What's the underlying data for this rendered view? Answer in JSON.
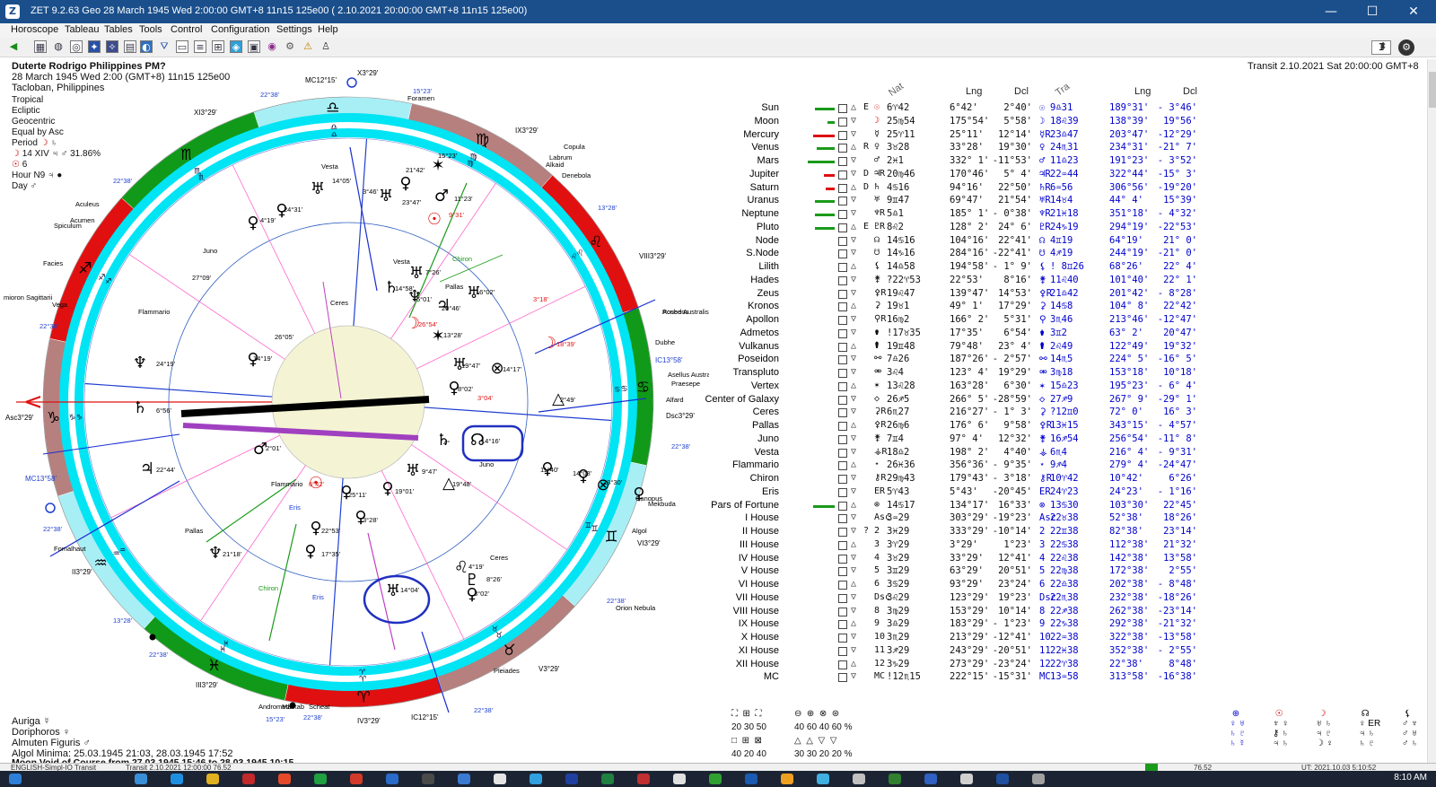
{
  "window": {
    "title": "ZET 9.2.63 Geo   28 March 1945  Wed   2:00:00 GMT+8 11n15  125e00  ( 2.10.2021  20:00:00 GMT+8 11n15 125e00)",
    "min": "—",
    "max": "☐",
    "close": "✕"
  },
  "menu": [
    "Horoscope",
    "Tableau",
    "Tables",
    "Tools",
    "Control",
    "Configuration",
    "Settings",
    "Help"
  ],
  "toolbar": {
    "zoom_value": "1"
  },
  "header": {
    "name": "Duterte Rodrigo Philippines PM?",
    "date": "28 March 1945  Wed    2:00  (GMT+8)  11n15  125e00",
    "place": "Tacloban, Philippines",
    "transit": "Transit  2.10.2021  Sat 20:00:00 GMT+8"
  },
  "settings_list": [
    "Tropical",
    "Ecliptic",
    "Geocentric",
    "Equal by Asc"
  ],
  "period": {
    "label": "Period",
    "line1": "14 XIV",
    "pct": "31.86%",
    "line2": "6",
    "hour": "Hour N9",
    "day": "Day"
  },
  "bottom_info": {
    "auriga": "Auriga",
    "doriphoros": "Doriphoros",
    "almuten": "Almuten Figuris",
    "algol": "Algol Minima: 25.03.1945 21:03,  28.03.1945 17:52",
    "moon_void": "Moon Void of Course from 27.03.1945 15:46 to 28.03.1945 10:15"
  },
  "table_headers": {
    "nat": "Nat",
    "lng": "Lng",
    "dcl": "Dcl",
    "tra": "Tra",
    "lng2": "Lng",
    "dcl2": "Dcl"
  },
  "table_rows": [
    {
      "name": "Sun",
      "bar": "#1a9a1a",
      "barw": 22,
      "flag": "E",
      "sym": "☉",
      "lng": "6♈42",
      "deg": "6°42'",
      "dcl": "2°40'",
      "tsym": "☉",
      "tlng": "9♎31",
      "tdeg": "189°31'",
      "tdcl": "- 3°46'"
    },
    {
      "name": "Moon",
      "bar": "#1a9a1a",
      "barw": 8,
      "flag": "",
      "sym": "☽",
      "lng": "25♍54",
      "deg": "175°54'",
      "dcl": "5°58'",
      "tsym": "☽",
      "tlng": "18♌39",
      "tdeg": "138°39'",
      "tdcl": "19°56'"
    },
    {
      "name": "Mercury",
      "bar": "#d11",
      "barw": 24,
      "flag": "",
      "sym": "☿",
      "lng": "25♈11",
      "deg": "25°11'",
      "dcl": "12°14'",
      "tsym": "☿R",
      "tlng": "23♎47",
      "tdeg": "203°47'",
      "tdcl": "-12°29'"
    },
    {
      "name": "Venus",
      "bar": "#1a9a1a",
      "barw": 20,
      "flag": "R",
      "sym": "♀",
      "lng": "3♉28",
      "deg": "33°28'",
      "dcl": "19°30'",
      "tsym": "♀",
      "tlng": "24♏31",
      "tdeg": "234°31'",
      "tdcl": "-21° 7'"
    },
    {
      "name": "Mars",
      "bar": "#1a9a1a",
      "barw": 30,
      "flag": "",
      "sym": "♂",
      "lng": "2♓1",
      "deg": "332° 1'",
      "dcl": "-11°53'",
      "tsym": "♂",
      "tlng": "11♎23",
      "tdeg": "191°23'",
      "tdcl": "- 3°52'"
    },
    {
      "name": "Jupiter",
      "bar": "#d11",
      "barw": 12,
      "flag": "D",
      "sym": "♃R",
      "lng": "20♍46",
      "deg": "170°46'",
      "dcl": "5° 4'",
      "tsym": "♃R",
      "tlng": "22♒44",
      "tdeg": "322°44'",
      "tdcl": "-15° 3'"
    },
    {
      "name": "Saturn",
      "bar": "#d11",
      "barw": 10,
      "flag": "D",
      "sym": "♄",
      "lng": "4♋16",
      "deg": "94°16'",
      "dcl": "22°50'",
      "tsym": "♄R",
      "tlng": "6♒56",
      "tdeg": "306°56'",
      "tdcl": "-19°20'"
    },
    {
      "name": "Uranus",
      "bar": "#1a9a1a",
      "barw": 22,
      "flag": "",
      "sym": "♅",
      "lng": "9♊47",
      "deg": "69°47'",
      "dcl": "21°54'",
      "tsym": "♅R",
      "tlng": "14♉4",
      "tdeg": "44° 4'",
      "tdcl": "15°39'"
    },
    {
      "name": "Neptune",
      "bar": "#1a9a1a",
      "barw": 22,
      "flag": "",
      "sym": "♆R",
      "lng": "5♎1",
      "deg": "185° 1'",
      "dcl": "- 0°38'",
      "tsym": "♆R",
      "tlng": "21♓18",
      "tdeg": "351°18'",
      "tdcl": "- 4°32'"
    },
    {
      "name": "Pluto",
      "bar": "#1a9a1a",
      "barw": 22,
      "flag": "E",
      "sym": "♇R",
      "lng": "8♌2",
      "deg": "128° 2'",
      "dcl": "24° 6'",
      "tsym": "♇R",
      "tlng": "24♑19",
      "tdeg": "294°19'",
      "tdcl": "-22°53'"
    },
    {
      "name": "Node",
      "bar": "",
      "barw": 0,
      "flag": "",
      "sym": "☊",
      "lng": "14♋16",
      "deg": "104°16'",
      "dcl": "22°41'",
      "tsym": "☊",
      "tlng": "4♊19",
      "tdeg": "64°19'",
      "tdcl": "21° 0'"
    },
    {
      "name": "S.Node",
      "bar": "",
      "barw": 0,
      "flag": "",
      "sym": "☋",
      "lng": "14♑16",
      "deg": "284°16'",
      "dcl": "-22°41'",
      "tsym": "☋",
      "tlng": "4♐19",
      "tdeg": "244°19'",
      "tdcl": "-21° 0'"
    },
    {
      "name": "Lilith",
      "bar": "",
      "barw": 0,
      "flag": "",
      "sym": "⚸",
      "lng": "14♎58",
      "deg": "194°58'",
      "dcl": "- 1° 9'",
      "tsym": "⚸",
      "tlng": "! 8♊26",
      "tdeg": "68°26'",
      "tdcl": "22° 4'"
    },
    {
      "name": "Hades",
      "bar": "",
      "barw": 0,
      "flag": "",
      "sym": "⚵",
      "lng": "?22♈53",
      "deg": "22°53'",
      "dcl": "8°16'",
      "tsym": "⚵",
      "tlng": "11♌40",
      "tdeg": "101°40'",
      "tdcl": "22° 1'"
    },
    {
      "name": "Zeus",
      "bar": "",
      "barw": 0,
      "flag": "",
      "sym": "⚴R",
      "lng": "19♌47",
      "deg": "139°47'",
      "dcl": "14°53'",
      "tsym": "⚴R",
      "tlng": "21♎42",
      "tdeg": "201°42'",
      "tdcl": "- 8°28'"
    },
    {
      "name": "Kronos",
      "bar": "",
      "barw": 0,
      "flag": "",
      "sym": "⚳",
      "lng": "19♉1",
      "deg": "49° 1'",
      "dcl": "17°29'",
      "tsym": "⚳",
      "tlng": "14♋8",
      "tdeg": "104° 8'",
      "tdcl": "22°42'"
    },
    {
      "name": "Apollon",
      "bar": "",
      "barw": 0,
      "flag": "",
      "sym": "⚲R",
      "lng": "16♍2",
      "deg": "166° 2'",
      "dcl": "5°31'",
      "tsym": "⚲",
      "tlng": "3♏46",
      "tdeg": "213°46'",
      "tdcl": "-12°47'"
    },
    {
      "name": "Admetos",
      "bar": "",
      "barw": 0,
      "flag": "",
      "sym": "⚱",
      "lng": "!17♉35",
      "deg": "17°35'",
      "dcl": "6°54'",
      "tsym": "⚱",
      "tlng": "3♊2",
      "tdeg": "63° 2'",
      "tdcl": "20°47'"
    },
    {
      "name": "Vulkanus",
      "bar": "",
      "barw": 0,
      "flag": "",
      "sym": "⚰",
      "lng": "19♊48",
      "deg": "79°48'",
      "dcl": "23° 4'",
      "tsym": "⚰",
      "tlng": "2♌49",
      "tdeg": "122°49'",
      "tdcl": "19°32'"
    },
    {
      "name": "Poseidon",
      "bar": "",
      "barw": 0,
      "flag": "",
      "sym": "⚯",
      "lng": "7♎26",
      "deg": "187°26'",
      "dcl": "- 2°57'",
      "tsym": "⚯",
      "tlng": "14♏5",
      "tdeg": "224° 5'",
      "tdcl": "-16° 5'"
    },
    {
      "name": "Transpluto",
      "bar": "",
      "barw": 0,
      "flag": "",
      "sym": "⚮",
      "lng": "3♌4",
      "deg": "123° 4'",
      "dcl": "19°29'",
      "tsym": "⚮",
      "tlng": "3♍18",
      "tdeg": "153°18'",
      "tdcl": "10°18'"
    },
    {
      "name": "Vertex",
      "bar": "",
      "barw": 0,
      "flag": "",
      "sym": "✶",
      "lng": "13♌28",
      "deg": "163°28'",
      "dcl": "6°30'",
      "tsym": "✶",
      "tlng": "15♎23",
      "tdeg": "195°23'",
      "tdcl": "- 6° 4'"
    },
    {
      "name": "Center of Galaxy",
      "bar": "",
      "barw": 0,
      "flag": "",
      "sym": "◇",
      "lng": "26♐5",
      "deg": "266° 5'",
      "dcl": "-28°59'",
      "tsym": "◇",
      "tlng": "27♐9",
      "tdeg": "267° 9'",
      "tdcl": "-29° 1'"
    },
    {
      "name": "Ceres",
      "bar": "",
      "barw": 0,
      "flag": "",
      "sym": "⚳R",
      "lng": "6♏27",
      "deg": "216°27'",
      "dcl": "- 1° 3'",
      "tsym": "⚳",
      "tlng": "?12♊0",
      "tdeg": "72° 0'",
      "tdcl": "16° 3'"
    },
    {
      "name": "Pallas",
      "bar": "",
      "barw": 0,
      "flag": "",
      "sym": "⚴R",
      "lng": "26♍6",
      "deg": "176° 6'",
      "dcl": "9°58'",
      "tsym": "⚴R",
      "tlng": "13♓15",
      "tdeg": "343°15'",
      "tdcl": "- 4°57'"
    },
    {
      "name": "Juno",
      "bar": "",
      "barw": 0,
      "flag": "",
      "sym": "⚵",
      "lng": "7♊4",
      "deg": "97° 4'",
      "dcl": "12°32'",
      "tsym": "⚵",
      "tlng": "16♐54",
      "tdeg": "256°54'",
      "tdcl": "-11° 8'"
    },
    {
      "name": "Vesta",
      "bar": "",
      "barw": 0,
      "flag": "",
      "sym": "⚶R",
      "lng": "18♎2",
      "deg": "198° 2'",
      "dcl": "4°40'",
      "tsym": "⚶",
      "tlng": "6♏4",
      "tdeg": "216° 4'",
      "tdcl": "- 9°31'"
    },
    {
      "name": "Flammario",
      "bar": "",
      "barw": 0,
      "flag": "",
      "sym": "⋆",
      "lng": "26♓36",
      "deg": "356°36'",
      "dcl": "- 9°35'",
      "tsym": "⋆",
      "tlng": "9♐4",
      "tdeg": "279° 4'",
      "tdcl": "-24°47'"
    },
    {
      "name": "Chiron",
      "bar": "",
      "barw": 0,
      "flag": "",
      "sym": "⚷R",
      "lng": "29♍43",
      "deg": "179°43'",
      "dcl": "- 3°18'",
      "tsym": "⚷R",
      "tlng": "10♈42",
      "tdeg": "10°42'",
      "tdcl": "6°26'"
    },
    {
      "name": "Eris",
      "bar": "",
      "barw": 0,
      "flag": "",
      "sym": "ER",
      "lng": "5♈43",
      "deg": "5°43'",
      "dcl": "-20°45'",
      "tsym": "ER",
      "tlng": "24♈23",
      "tdeg": "24°23'",
      "tdcl": "- 1°16'"
    },
    {
      "name": "Pars of Fortune",
      "bar": "#1a9a1a",
      "barw": 24,
      "flag": "",
      "sym": "⊗",
      "lng": "14♋17",
      "deg": "134°17'",
      "dcl": "16°33'",
      "tsym": "⊗",
      "tlng": "13♋30",
      "tdeg": "103°30'",
      "tdcl": "22°45'"
    },
    {
      "name": "I House",
      "bar": "",
      "barw": 0,
      "flag": "",
      "sym": "Asc",
      "lng": "3♒29",
      "deg": "303°29'",
      "dcl": "-19°23'",
      "tsym": "Asc",
      "tlng": "22♉38",
      "tdeg": "52°38'",
      "tdcl": "18°26'"
    },
    {
      "name": "II House",
      "bar": "",
      "barw": 0,
      "flag": "?",
      "sym": "2",
      "lng": "3♓29",
      "deg": "333°29'",
      "dcl": "-10°14'",
      "tsym": "2",
      "tlng": "22♊38",
      "tdeg": "82°38'",
      "tdcl": "23°14'"
    },
    {
      "name": "III House",
      "bar": "",
      "barw": 0,
      "flag": "",
      "sym": "3",
      "lng": "3♈29",
      "deg": "3°29'",
      "dcl": "1°23'",
      "tsym": "3",
      "tlng": "22♋38",
      "tdeg": "112°38'",
      "tdcl": "21°32'"
    },
    {
      "name": "IV House",
      "bar": "",
      "barw": 0,
      "flag": "",
      "sym": "4",
      "lng": "3♉29",
      "deg": "33°29'",
      "dcl": "12°41'",
      "tsym": "4",
      "tlng": "22♌38",
      "tdeg": "142°38'",
      "tdcl": "13°58'"
    },
    {
      "name": "V House",
      "bar": "",
      "barw": 0,
      "flag": "",
      "sym": "5",
      "lng": "3♊29",
      "deg": "63°29'",
      "dcl": "20°51'",
      "tsym": "5",
      "tlng": "22♍38",
      "tdeg": "172°38'",
      "tdcl": "2°55'"
    },
    {
      "name": "VI House",
      "bar": "",
      "barw": 0,
      "flag": "",
      "sym": "6",
      "lng": "3♋29",
      "deg": "93°29'",
      "dcl": "23°24'",
      "tsym": "6",
      "tlng": "22♎38",
      "tdeg": "202°38'",
      "tdcl": "- 8°48'"
    },
    {
      "name": "VII House",
      "bar": "",
      "barw": 0,
      "flag": "",
      "sym": "Dsc",
      "lng": "3♌29",
      "deg": "123°29'",
      "dcl": "19°23'",
      "tsym": "Dsc",
      "tlng": "22♏38",
      "tdeg": "232°38'",
      "tdcl": "-18°26'"
    },
    {
      "name": "VIII House",
      "bar": "",
      "barw": 0,
      "flag": "",
      "sym": "8",
      "lng": "3♍29",
      "deg": "153°29'",
      "dcl": "10°14'",
      "tsym": "8",
      "tlng": "22♐38",
      "tdeg": "262°38'",
      "tdcl": "-23°14'"
    },
    {
      "name": "IX House",
      "bar": "",
      "barw": 0,
      "flag": "",
      "sym": "9",
      "lng": "3♎29",
      "deg": "183°29'",
      "dcl": "- 1°23'",
      "tsym": "9",
      "tlng": "22♑38",
      "tdeg": "292°38'",
      "tdcl": "-21°32'"
    },
    {
      "name": "X House",
      "bar": "",
      "barw": 0,
      "flag": "",
      "sym": "10",
      "lng": "3♏29",
      "deg": "213°29'",
      "dcl": "-12°41'",
      "tsym": "10",
      "tlng": "22♒38",
      "tdeg": "322°38'",
      "tdcl": "-13°58'"
    },
    {
      "name": "XI House",
      "bar": "",
      "barw": 0,
      "flag": "",
      "sym": "11",
      "lng": "3♐29",
      "deg": "243°29'",
      "dcl": "-20°51'",
      "tsym": "11",
      "tlng": "22♓38",
      "tdeg": "352°38'",
      "tdcl": "- 2°55'"
    },
    {
      "name": "XII House",
      "bar": "",
      "barw": 0,
      "flag": "",
      "sym": "12",
      "lng": "3♑29",
      "deg": "273°29'",
      "dcl": "-23°24'",
      "tsym": "12",
      "tlng": "22♈38",
      "tdeg": "22°38'",
      "tdcl": "8°48'"
    },
    {
      "name": "MC",
      "bar": "",
      "barw": 0,
      "flag": "",
      "sym": "MC",
      "lng": "!12♏15",
      "deg": "222°15'",
      "dcl": "-15°31'",
      "tsym": "MC",
      "tlng": "13♒58",
      "tdeg": "313°58'",
      "tdcl": "-16°38'"
    }
  ],
  "legend_bottom": {
    "row1": "20  30  50",
    "row2": "40  20  40",
    "pct1": "40  60  40  60 %",
    "pct2": "30  30  20  20 %"
  },
  "status": {
    "left": "ENGLISH-Simpl-IO Transit",
    "mid": "Transit  2.10.2021 12:00:00  76.52",
    "right1": "76.52",
    "right2": "UT: 2021.10.03  5:10:52"
  },
  "clock": "8:10 AM",
  "wheel": {
    "signs": [
      "♈",
      "♉",
      "♊",
      "♋",
      "♌",
      "♍",
      "♎",
      "♏",
      "♐",
      "♑",
      "♒",
      "♓"
    ],
    "houses": [
      "Asc",
      "II",
      "III",
      "IC",
      "V",
      "VI",
      "Dsc",
      "VIII",
      "IX",
      "MC",
      "XI",
      "XII"
    ],
    "labels": {
      "x": "X3°29'",
      "mc": "MC12°15'",
      "xi": "XI3°29'",
      "ix": "IX3°29'",
      "viii": "VIII3°29'",
      "ic": "IC12°15'",
      "iv": "IV3°29'",
      "iii": "III3°29'",
      "ii": "II3°29'",
      "asc": "Asc3°29'",
      "dsc": "Dsc3°29'",
      "vi": "VI3°29'",
      "v": "V3°29'",
      "mc2": "MC13°58'",
      "ic2": "IC13°58'"
    },
    "stars": [
      "Foramen",
      "Copula",
      "Labrum",
      "Alkaid",
      "Denebola",
      "Aculeus",
      "Acumen",
      "Spiculum",
      "Facies",
      "mioron Sagittarii",
      "Vega",
      "Fomalhaut",
      "Andromeda",
      "Scheat",
      "Markab",
      "Pleiades",
      "Orion Nebula",
      "Canopus",
      "Mekbuda",
      "Asellus Australis",
      "Praesepe",
      "Alfard",
      "Dubhe",
      "Posed Australis",
      "Acubens",
      "Algol"
    ],
    "tick_labels": [
      "22°38'",
      "15°23'",
      "22°38'",
      "13°28'",
      "22°38'",
      "22°38'",
      "13°28'",
      "22°38'",
      "22°38'",
      "15°23'",
      "22°38'",
      "22°38'",
      "22°38'"
    ],
    "inner_labels": [
      {
        "t": "Vesta"
      },
      {
        "t": "14°05'"
      },
      {
        "t": "3°46'"
      },
      {
        "t": "21°42'"
      },
      {
        "t": "23°47'"
      },
      {
        "t": "15°23'"
      },
      {
        "t": "11°23'"
      },
      {
        "t": "24°31'"
      },
      {
        "t": "4°19'"
      },
      {
        "t": "9°31'"
      },
      {
        "t": "Juno"
      },
      {
        "t": "27°09'"
      },
      {
        "t": "Flammario"
      },
      {
        "t": "26°05'"
      },
      {
        "t": "14°19'"
      },
      {
        "t": "24°19'"
      },
      {
        "t": "6°56'"
      },
      {
        "t": "22°44'"
      },
      {
        "t": "2°01'"
      },
      {
        "t": "Flammario"
      },
      {
        "t": "6°42'"
      },
      {
        "t": "25°11'"
      },
      {
        "t": "19°01'"
      },
      {
        "t": "3°28'"
      },
      {
        "t": "22°53'"
      },
      {
        "t": "17°35'"
      },
      {
        "t": "21°18'"
      },
      {
        "t": "Pallas"
      },
      {
        "t": "Chiron"
      },
      {
        "t": "Eris"
      },
      {
        "t": "Eris"
      },
      {
        "t": "14°04'"
      },
      {
        "t": "4°19'"
      },
      {
        "t": "8°26'"
      },
      {
        "t": "3°02'"
      },
      {
        "t": "Ceres"
      },
      {
        "t": "Juno"
      },
      {
        "t": "19°48'"
      },
      {
        "t": "9°47'"
      },
      {
        "t": "14°16'"
      },
      {
        "t": "4°"
      },
      {
        "t": "11°40'"
      },
      {
        "t": "14°08'"
      },
      {
        "t": "13°30'"
      },
      {
        "t": "2°49'"
      },
      {
        "t": "14°17'"
      },
      {
        "t": "19°47'"
      },
      {
        "t": "8°02'"
      },
      {
        "t": "3°04'"
      },
      {
        "t": "18°39'"
      },
      {
        "t": "13°28'"
      },
      {
        "t": "26°54'"
      },
      {
        "t": "20°46'"
      },
      {
        "t": "16°02'"
      },
      {
        "t": "3°18'"
      },
      {
        "t": "Vesta"
      },
      {
        "t": "7°26'"
      },
      {
        "t": "14°58'"
      },
      {
        "t": "5°01'"
      },
      {
        "t": "Pallas"
      },
      {
        "t": "Chiron"
      },
      {
        "t": "Ceres"
      }
    ]
  }
}
